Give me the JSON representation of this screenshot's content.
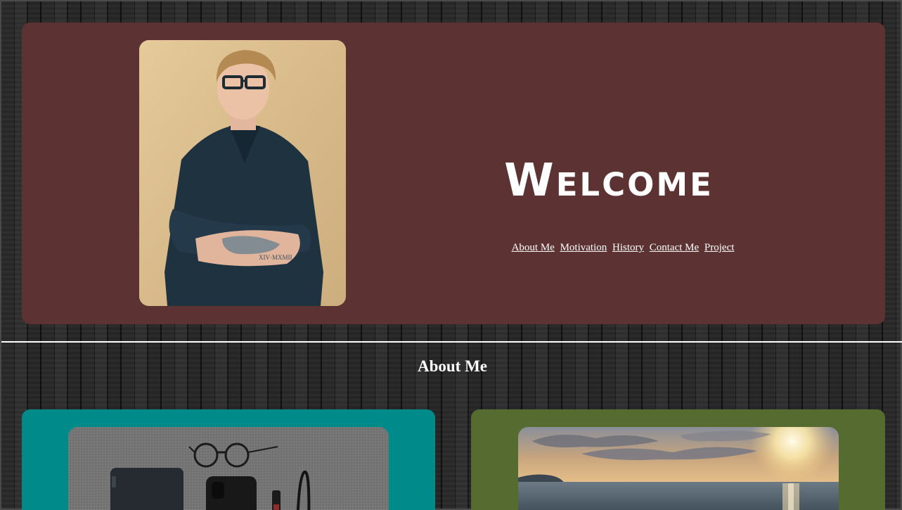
{
  "hero": {
    "title": "Welcome",
    "portrait_alt": "Portrait photo of a man with glasses and crossed arms"
  },
  "nav": {
    "items": [
      {
        "label": "About Me"
      },
      {
        "label": "Motivation"
      },
      {
        "label": "History"
      },
      {
        "label": "Contact Me"
      },
      {
        "label": "Project"
      }
    ]
  },
  "about": {
    "title": "About Me"
  },
  "colors": {
    "hero_bg": "#5c3232",
    "card_teal": "#008b8b",
    "card_green": "#556b2f",
    "text": "#ffffff"
  },
  "icons": {
    "portrait": "portrait-photo",
    "desk_items": "desk-items-photo",
    "sunset": "sea-sunset-photo"
  }
}
